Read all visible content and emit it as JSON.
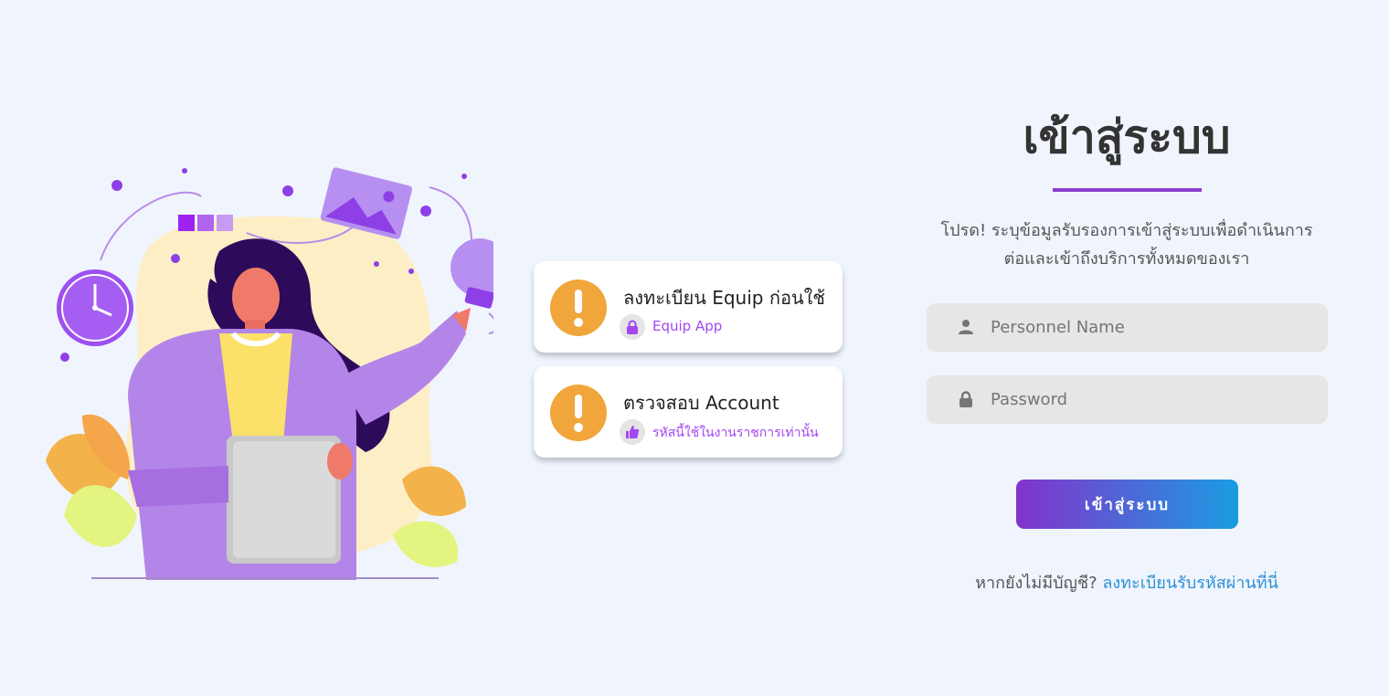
{
  "cards": [
    {
      "title": "ลงทะเบียน Equip ก่อนใช้",
      "subtitle": "Equip App",
      "sub_icon": "lock-icon"
    },
    {
      "title": "ตรวจสอบ Account",
      "subtitle": "รหัสนี้ใช้ในงานราชการเท่านั้น",
      "sub_icon": "thumbs-up-icon"
    }
  ],
  "login": {
    "title": "เข้าสู่ระบบ",
    "subtitle_line1": "โปรด! ระบุข้อมูลรับรองการเข้าสู่ระบบเพื่อดำเนินการ",
    "subtitle_line2": "ต่อและเข้าถึงบริการทั้งหมดของเรา",
    "username": {
      "placeholder": "Personnel Name",
      "value": ""
    },
    "password": {
      "placeholder": "Password",
      "value": ""
    },
    "submit_label": "เข้าสู่ระบบ",
    "register_prompt": "หากยังไม่มีบัญชี?",
    "register_link": "ลงทะเบียนรับรหัสผ่านที่นี่"
  },
  "colors": {
    "background": "#f0f5fd",
    "accent_purple": "#8a3fcf",
    "button_gradient_start": "#8233cc",
    "button_gradient_end": "#1a9ce1",
    "link": "#2f8fd5",
    "warning": "#f0a63a",
    "field_bg": "#e6e6e6"
  }
}
